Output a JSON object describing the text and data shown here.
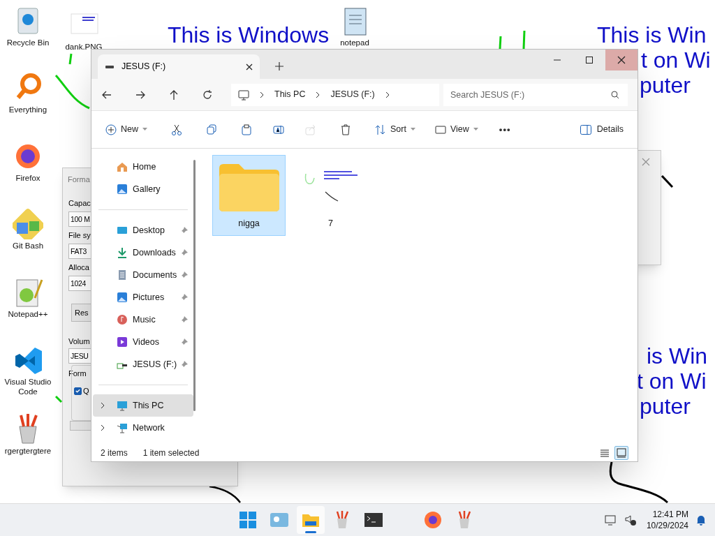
{
  "wallpaper_texts": [
    {
      "text": "This is Windows"
    },
    {
      "text": "This is Win"
    },
    {
      "text": "t on Wi"
    },
    {
      "text": "puter"
    },
    {
      "text": "is Win"
    },
    {
      "text": "t on Wi"
    },
    {
      "text": "puter"
    }
  ],
  "desktop_icons": [
    {
      "label": "Recycle Bin"
    },
    {
      "label": "Everything"
    },
    {
      "label": "Firefox"
    },
    {
      "label": "Git Bash"
    },
    {
      "label": "Notepad++"
    },
    {
      "label": "Visual Studio Code"
    },
    {
      "label": "rgergtergtere"
    },
    {
      "label": "dank.PNG"
    },
    {
      "label": "notepad"
    }
  ],
  "format_dialog": {
    "title": "Forma",
    "texts": [
      "Capac",
      "File sy",
      "Alloca",
      "Volum",
      "Form"
    ],
    "fields": [
      "100 M",
      "FAT3",
      "1024",
      "JESU"
    ],
    "button": "Res",
    "quick_checkbox": {
      "label": "Q",
      "checked": true
    }
  },
  "explorer": {
    "tab": {
      "title": "JESUS (F:)"
    },
    "breadcrumb": [
      "This PC",
      "JESUS (F:)"
    ],
    "search": {
      "placeholder": "Search JESUS (F:)"
    },
    "commands": [
      {
        "kind": "new",
        "label": "New"
      },
      {
        "kind": "cut"
      },
      {
        "kind": "copy"
      },
      {
        "kind": "paste"
      },
      {
        "kind": "rename"
      },
      {
        "kind": "share",
        "disabled": true
      },
      {
        "kind": "delete"
      },
      {
        "kind": "sort",
        "label": "Sort"
      },
      {
        "kind": "view",
        "label": "View"
      },
      {
        "kind": "more",
        "label": "•••"
      }
    ],
    "details_button": "Details",
    "sidebar": [
      {
        "label": "Home",
        "kind": "plain",
        "selected": false
      },
      {
        "label": "Gallery",
        "kind": "plain",
        "selected": false
      },
      {
        "kind": "divider"
      },
      {
        "label": "Desktop",
        "kind": "pinned",
        "selected": false
      },
      {
        "label": "Downloads",
        "kind": "pinned",
        "selected": false
      },
      {
        "label": "Documents",
        "kind": "pinned",
        "selected": false
      },
      {
        "label": "Pictures",
        "kind": "pinned",
        "selected": false
      },
      {
        "label": "Music",
        "kind": "pinned",
        "selected": false
      },
      {
        "label": "Videos",
        "kind": "pinned",
        "selected": false
      },
      {
        "label": "JESUS (F:)",
        "kind": "pinned",
        "selected": false
      },
      {
        "kind": "divider"
      },
      {
        "label": "This PC",
        "kind": "tree",
        "selected": true
      },
      {
        "label": "Network",
        "kind": "tree",
        "selected": false
      }
    ],
    "items": [
      {
        "name": "nigga",
        "kind": "folder",
        "selected": true
      },
      {
        "name": "7",
        "kind": "picture",
        "selected": false
      }
    ],
    "status": {
      "count": "2 items",
      "selection": "1 item selected"
    },
    "view_modes": [
      {
        "kind": "details",
        "selected": false
      },
      {
        "kind": "tiles",
        "selected": true
      }
    ]
  },
  "taskbar": {
    "apps": [
      {
        "kind": "start",
        "active": false
      },
      {
        "kind": "widgets",
        "active": false
      },
      {
        "kind": "explorer",
        "active": true
      },
      {
        "kind": "paint",
        "active": false
      },
      {
        "kind": "terminal",
        "active": false
      },
      {
        "kind": "firefox",
        "active": false
      },
      {
        "kind": "paint",
        "active": false
      }
    ],
    "time": "12:41 PM",
    "date": "10/29/2024"
  }
}
